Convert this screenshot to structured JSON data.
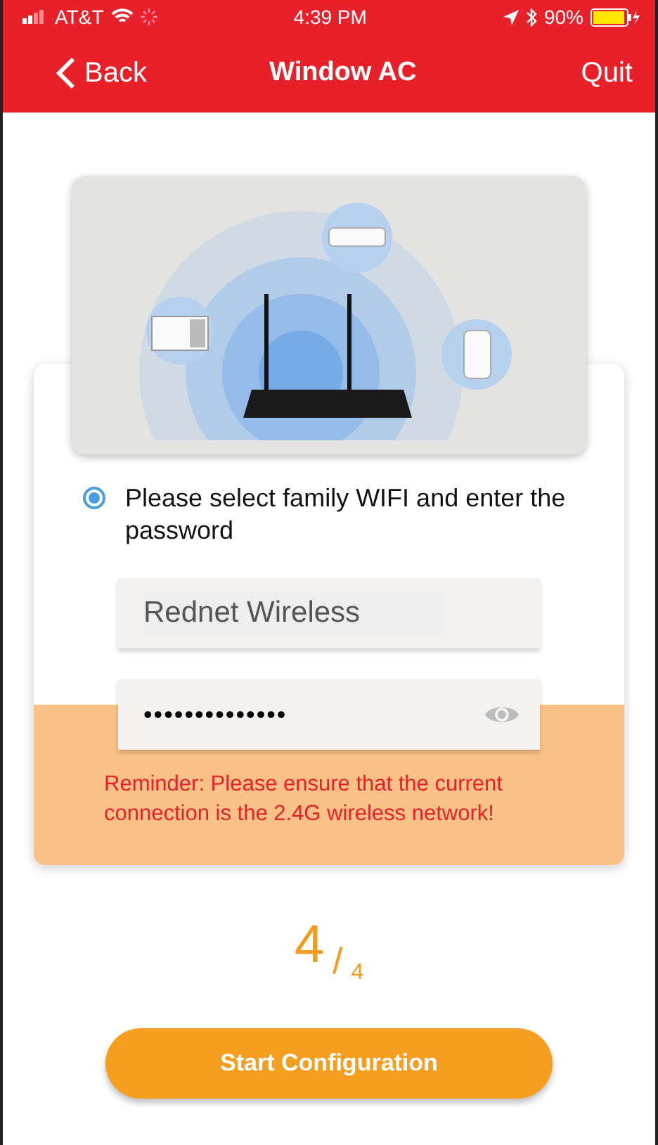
{
  "status_bar": {
    "carrier": "AT&T",
    "time": "4:39 PM",
    "battery": "90%"
  },
  "nav": {
    "back": "Back",
    "title": "Window AC",
    "action": "Quit"
  },
  "option": {
    "label": "Please select family WIFI and enter the password",
    "selected": true
  },
  "wifi_field": {
    "value": "Rednet Wireless"
  },
  "password_field": {
    "value": "••••••••••••••"
  },
  "reminder": "Reminder: Please ensure that the current connection is the 2.4G wireless network!",
  "step": {
    "current": "4",
    "separator": "/",
    "total": "4"
  },
  "button": "Start Configuration"
}
